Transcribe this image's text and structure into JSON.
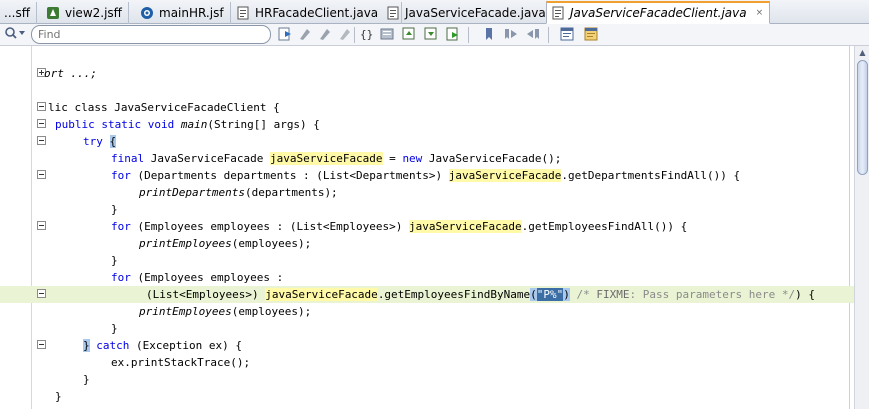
{
  "tabs": [
    {
      "label": "...sff",
      "icon": "jsff-file-icon",
      "active": false
    },
    {
      "label": "view2.jsff",
      "icon": "jsff-file-icon",
      "active": false
    },
    {
      "label": "mainHR.jsf",
      "icon": "jsf-file-icon",
      "active": false
    },
    {
      "label": "HRFacadeClient.java",
      "icon": "java-file-icon",
      "active": false
    },
    {
      "label": "JavaServiceFacade.java",
      "icon": "java-file-icon",
      "active": false
    },
    {
      "label": "JavaServiceFacadeClient.java",
      "icon": "java-file-icon",
      "active": true
    }
  ],
  "tab_close_glyph": "×",
  "toolbar": {
    "find_placeholder": "Find",
    "icons": [
      "search-icon",
      "go-to-source-icon",
      "toggle-previous-icon",
      "toggle-next-icon",
      "toggle-braces-icon",
      "reformat-icon",
      "structure-up-icon",
      "structure-down-icon",
      "run-to-cursor-icon",
      "bookmark-icon",
      "bookmark-next-icon",
      "bookmark-previous-icon",
      "block-comment-icon",
      "uncomment-icon"
    ]
  },
  "code": {
    "lines": [
      {
        "text": ""
      },
      {
        "text": "ort ...;",
        "fold": "plus"
      },
      {
        "text": ""
      },
      {
        "text": "lic class JavaServiceFacadeClient {",
        "fold": "minus"
      },
      {
        "text": "public static void main(String[] args) {",
        "fold": "minus"
      },
      {
        "text": "try {",
        "fold": "minus"
      },
      {
        "text": "final JavaServiceFacade javaServiceFacade = new JavaServiceFacade();"
      },
      {
        "text": "for (Departments departments : (List<Departments>) javaServiceFacade.getDepartmentsFindAll()) {",
        "fold": "minus"
      },
      {
        "text": "printDepartments(departments);"
      },
      {
        "text": "}"
      },
      {
        "text": "for (Employees employees : (List<Employees>) javaServiceFacade.getEmployeesFindAll()) {",
        "fold": "minus"
      },
      {
        "text": "printEmployees(employees);"
      },
      {
        "text": "}"
      },
      {
        "text": "for (Employees employees :"
      },
      {
        "text": "(List<Employees>) javaServiceFacade.getEmployeesFindByName(\"P%\") /* FIXME: Pass parameters here */) {",
        "fold": "minus",
        "current": true
      },
      {
        "text": "printEmployees(employees);"
      },
      {
        "text": "}"
      },
      {
        "text": "} catch (Exception ex) {",
        "fold": "minus"
      },
      {
        "text": "ex.printStackTrace();"
      },
      {
        "text": "}"
      },
      {
        "text": "}"
      }
    ],
    "highlight_identifier": "javaServiceFacade",
    "selected_text": "\"P%\""
  },
  "colors": {
    "keyword": "#0000e6",
    "highlight": "#fff9a8",
    "selection": "#3a6ea5",
    "current_line": "#eaf4d4",
    "active_tab_accent": "#f0a030"
  }
}
